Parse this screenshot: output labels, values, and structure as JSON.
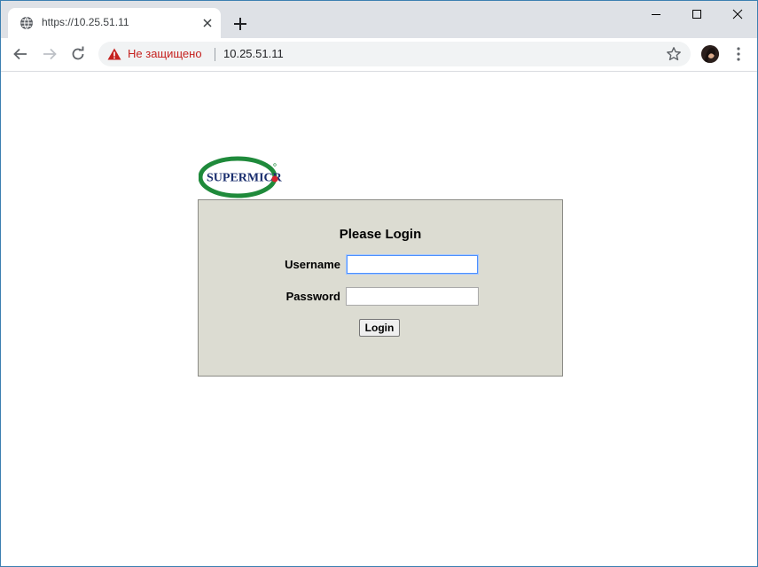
{
  "browser": {
    "tab": {
      "title": "https://10.25.51.11"
    },
    "omnibox": {
      "security_label": "Не защищено",
      "url": "10.25.51.11"
    }
  },
  "page": {
    "logo_text": "SUPERMICR",
    "login": {
      "heading": "Please Login",
      "username_label": "Username",
      "password_label": "Password",
      "username_value": "",
      "password_value": "",
      "button_label": "Login"
    }
  },
  "colors": {
    "login_panel_bg": "#dcdcd2",
    "not_secure_red": "#c5221f",
    "supermicro_green": "#1f8a3b",
    "supermicro_navy": "#1a2e6e",
    "supermicro_red_dot": "#d7232f"
  },
  "icons": {
    "tab_favicon": "globe-icon",
    "tab_close": "close-icon",
    "new_tab": "plus-icon",
    "back": "back-arrow-icon",
    "forward": "forward-arrow-icon",
    "reload": "reload-icon",
    "warning": "warning-triangle-icon",
    "bookmark": "star-icon",
    "profile": "avatar",
    "menu": "kebab-menu-icon"
  }
}
